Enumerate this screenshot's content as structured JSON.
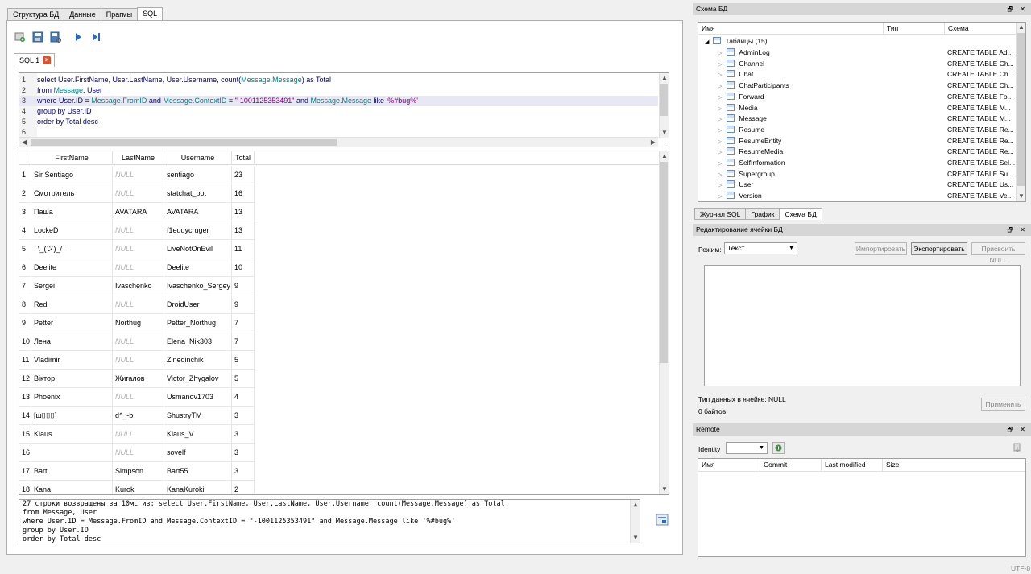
{
  "main_tabs": [
    "Структура БД",
    "Данные",
    "Прагмы",
    "SQL"
  ],
  "toolbar_icons": [
    "open-tab-icon",
    "save-icon",
    "save-as-icon",
    "execute-icon",
    "execute-line-icon"
  ],
  "sql_tab": {
    "label": "SQL 1"
  },
  "editor": {
    "lines": [
      [
        "select ",
        "User.FirstName",
        ", ",
        "User.LastName",
        ", ",
        "User.Username",
        ", ",
        "count(",
        "Message.Message",
        ") as Total"
      ],
      [
        "from ",
        "Message",
        ", User"
      ],
      [
        "where ",
        "User.ID",
        " = ",
        "Message.FromID",
        " and ",
        "Message.ContextID",
        " = ",
        "\"-1001125353491\"",
        " and ",
        "Message.Message",
        " like ",
        "'%#bug%'"
      ],
      [
        "group by ",
        "User.ID"
      ],
      [
        "order by ",
        "Total desc"
      ],
      [
        ""
      ]
    ],
    "line_numbers": [
      "1",
      "2",
      "3",
      "4",
      "5",
      "6"
    ]
  },
  "grid": {
    "headers": [
      "FirstName",
      "LastName",
      "Username",
      "Total"
    ],
    "rows": [
      [
        "1",
        "Sir Sentiago",
        "NULL",
        "sentiago",
        "23"
      ],
      [
        "2",
        "Смотритель",
        "NULL",
        "statchat_bot",
        "16"
      ],
      [
        "3",
        "Паша",
        "AVATARA",
        "AVATARA",
        "13"
      ],
      [
        "4",
        "LockeD",
        "NULL",
        "f1eddycruger",
        "13"
      ],
      [
        "5",
        "¯\\_(ツ)_/¯",
        "NULL",
        "LiveNotOnEvil",
        "11"
      ],
      [
        "6",
        "Deelite",
        "NULL",
        "Deelite",
        "10"
      ],
      [
        "7",
        "Sergei",
        "Ivaschenko",
        "Ivaschenko_Sergey",
        "9"
      ],
      [
        "8",
        "Red",
        "NULL",
        "DroidUser",
        "9"
      ],
      [
        "9",
        "Petter",
        "Northug",
        "Petter_Northug",
        "7"
      ],
      [
        "10",
        "Лена",
        "NULL",
        "Elena_Nik303",
        "7"
      ],
      [
        "11",
        "Vladimir",
        "NULL",
        "Zinedinchik",
        "5"
      ],
      [
        "12",
        "Віктор",
        "Жигалов",
        "Victor_Zhygalov",
        "5"
      ],
      [
        "13",
        "Phoenix",
        "NULL",
        "Usmanov1703",
        "4"
      ],
      [
        "14",
        "[ш⌷⌷⌷]",
        "d^_-b",
        "ShustryTM",
        "3"
      ],
      [
        "15",
        "Klaus",
        "NULL",
        "Klaus_V",
        "3"
      ],
      [
        "16",
        "",
        "NULL",
        "sovelf",
        "3"
      ],
      [
        "17",
        "Bart",
        "Simpson",
        "Bart55",
        "3"
      ],
      [
        "18",
        "Kana",
        "Kuroki",
        "KanaKuroki",
        "2"
      ]
    ]
  },
  "log": {
    "lines": [
      "27 строки возвращены за 10мс из: select User.FirstName, User.LastName, User.Username, count(Message.Message) as Total",
      "from Message, User",
      "where User.ID = Message.FromID and Message.ContextID = \"-1001125353491\" and Message.Message like '%#bug%'",
      "group by User.ID",
      "order by Total desc"
    ]
  },
  "schema_panel": {
    "title": "Схема БД",
    "columns": [
      "Имя",
      "Тип",
      "Схема"
    ],
    "root": "Таблицы (15)",
    "tables": [
      [
        "AdminLog",
        "CREATE TABLE Ad..."
      ],
      [
        "Channel",
        "CREATE TABLE Ch..."
      ],
      [
        "Chat",
        "CREATE TABLE Ch..."
      ],
      [
        "ChatParticipants",
        "CREATE TABLE Ch..."
      ],
      [
        "Forward",
        "CREATE TABLE Fo..."
      ],
      [
        "Media",
        "CREATE TABLE M..."
      ],
      [
        "Message",
        "CREATE TABLE M..."
      ],
      [
        "Resume",
        "CREATE TABLE Re..."
      ],
      [
        "ResumeEntity",
        "CREATE TABLE Re..."
      ],
      [
        "ResumeMedia",
        "CREATE TABLE Re..."
      ],
      [
        "SelfInformation",
        "CREATE TABLE Sel..."
      ],
      [
        "Supergroup",
        "CREATE TABLE Su..."
      ],
      [
        "User",
        "CREATE TABLE Us..."
      ],
      [
        "Version",
        "CREATE TABLE Ve..."
      ]
    ]
  },
  "bottom_tabs": [
    "Журнал SQL",
    "График",
    "Схема БД"
  ],
  "edit_cell": {
    "title": "Редактирование ячейки БД",
    "mode_label": "Режим:",
    "mode_value": "Текст",
    "import_btn": "Импортировать",
    "export_btn": "Экспортировать",
    "null_btn": "Присвоить NULL",
    "type_label": "Тип данных в ячейке: NULL",
    "size_label": "0 байтов",
    "apply_btn": "Применить"
  },
  "remote": {
    "title": "Remote",
    "identity_label": "Identity",
    "columns": [
      "Имя",
      "Commit",
      "Last modified",
      "Size"
    ]
  },
  "status": {
    "encoding": "UTF-8"
  }
}
